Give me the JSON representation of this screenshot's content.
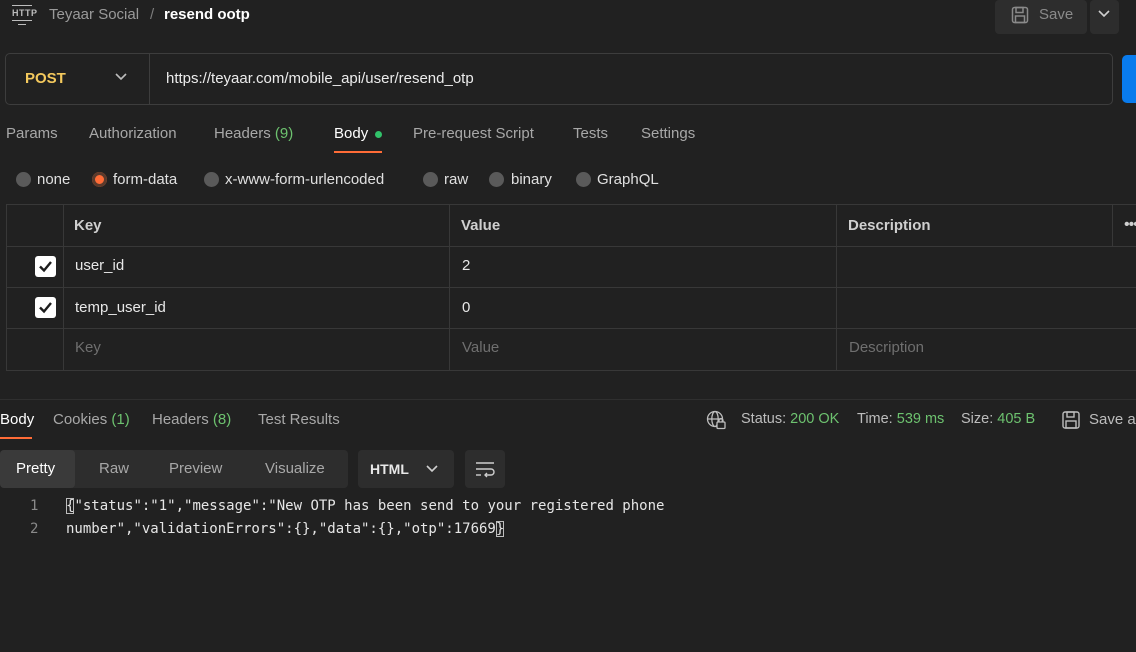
{
  "header": {
    "icon": "http-icon",
    "icon_text": "HTTP",
    "app_name": "Teyaar Social",
    "separator": "/",
    "request_name": "resend ootp",
    "save_label": "Save"
  },
  "request": {
    "method": "POST",
    "url": "https://teyaar.com/mobile_api/user/resend_otp"
  },
  "request_tabs": [
    {
      "label": "Params"
    },
    {
      "label": "Authorization"
    },
    {
      "label": "Headers",
      "count": "(9)"
    },
    {
      "label": "Body",
      "active": true
    },
    {
      "label": "Pre-request Script"
    },
    {
      "label": "Tests"
    },
    {
      "label": "Settings"
    }
  ],
  "body_types": [
    {
      "label": "none"
    },
    {
      "label": "form-data",
      "selected": true
    },
    {
      "label": "x-www-form-urlencoded"
    },
    {
      "label": "raw"
    },
    {
      "label": "binary"
    },
    {
      "label": "GraphQL"
    }
  ],
  "params_table": {
    "headers": [
      "Key",
      "Value",
      "Description"
    ],
    "rows": [
      {
        "checked": true,
        "key": "user_id",
        "value": "2",
        "description": ""
      },
      {
        "checked": true,
        "key": "temp_user_id",
        "value": "0",
        "description": ""
      }
    ],
    "placeholder": {
      "key": "Key",
      "value": "Value",
      "description": "Description"
    },
    "more": "•••"
  },
  "response": {
    "tabs": [
      {
        "label": "Body",
        "active": true
      },
      {
        "label": "Cookies",
        "count": "(1)"
      },
      {
        "label": "Headers",
        "count": "(8)"
      },
      {
        "label": "Test Results"
      }
    ],
    "status_label": "Status:",
    "status_value": "200 OK",
    "time_label": "Time:",
    "time_value": "539 ms",
    "size_label": "Size:",
    "size_value": "405 B",
    "save_as": "Save a",
    "view_modes": [
      "Pretty",
      "Raw",
      "Preview",
      "Visualize"
    ],
    "active_view": "Pretty",
    "format": "HTML",
    "lines": [
      {
        "num": "1",
        "text_open": "{",
        "text": "\"status\":\"1\",\"message\":\"New OTP has been send to your registered phone"
      },
      {
        "num": "2",
        "text": "number\",\"validationErrors\":{},\"data\":{},\"otp\":17669",
        "text_close": "}"
      }
    ]
  },
  "colors": {
    "accent": "#ff6c37",
    "method": "#f4c95d",
    "success": "#6dc26f",
    "send": "#097bed"
  }
}
